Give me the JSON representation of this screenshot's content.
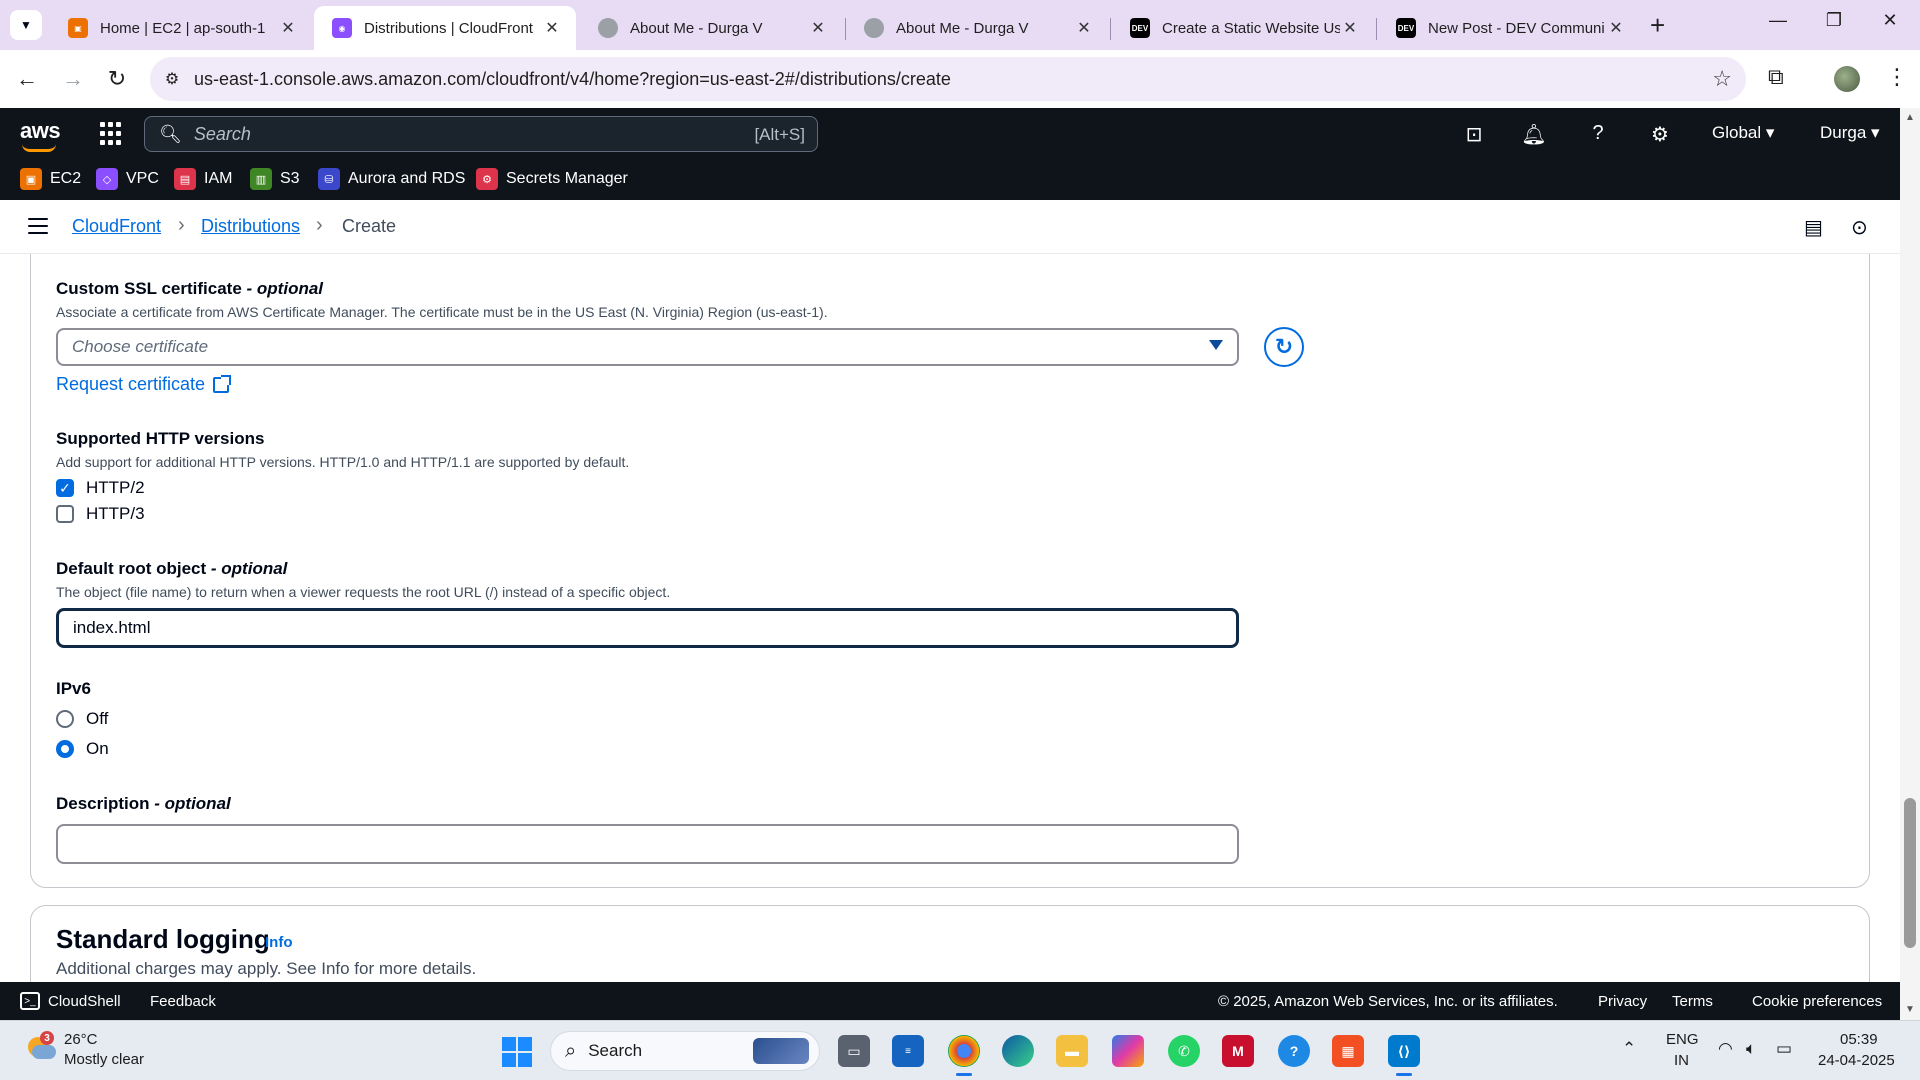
{
  "browser": {
    "tabs": [
      {
        "title": "Home | EC2 | ap-south-1",
        "icon": "aws-ec2-icon",
        "color": "#ed7100"
      },
      {
        "title": "Distributions | CloudFront",
        "icon": "aws-cloudfront-icon",
        "color": "#8c4fff"
      },
      {
        "title": "About Me - Durga V",
        "icon": "globe-icon",
        "color": "#9aa0a6"
      },
      {
        "title": "About Me - Durga V",
        "icon": "globe-icon",
        "color": "#9aa0a6"
      },
      {
        "title": "Create a Static Website Usi",
        "icon": "dev-icon",
        "color": "#000000"
      },
      {
        "title": "New Post - DEV Communi",
        "icon": "dev-icon",
        "color": "#000000"
      }
    ],
    "url": "us-east-1.console.aws.amazon.com/cloudfront/v4/home?region=us-east-2#/distributions/create"
  },
  "aws_header": {
    "logo": "aws",
    "search_placeholder": "Search",
    "search_shortcut": "[Alt+S]",
    "region": "Global",
    "user": "Durga"
  },
  "favorites": [
    {
      "label": "EC2",
      "icon": "ec2-icon",
      "color": "#ed7100"
    },
    {
      "label": "VPC",
      "icon": "vpc-icon",
      "color": "#8c4fff"
    },
    {
      "label": "IAM",
      "icon": "iam-icon",
      "color": "#dd344c"
    },
    {
      "label": "S3",
      "icon": "s3-icon",
      "color": "#3f8624"
    },
    {
      "label": "Aurora and RDS",
      "icon": "rds-icon",
      "color": "#3b48cc"
    },
    {
      "label": "Secrets Manager",
      "icon": "secrets-manager-icon",
      "color": "#dd344c"
    }
  ],
  "breadcrumb": {
    "items": [
      "CloudFront",
      "Distributions",
      "Create"
    ]
  },
  "form": {
    "ssl": {
      "label": "Custom SSL certificate",
      "optional": "- optional",
      "description": "Associate a certificate from AWS Certificate Manager. The certificate must be in the US East (N. Virginia) Region (us-east-1).",
      "placeholder": "Choose certificate",
      "request_link": "Request certificate"
    },
    "http": {
      "label": "Supported HTTP versions",
      "description": "Add support for additional HTTP versions. HTTP/1.0 and HTTP/1.1 are supported by default.",
      "options": [
        {
          "label": "HTTP/2",
          "checked": true
        },
        {
          "label": "HTTP/3",
          "checked": false
        }
      ]
    },
    "root_object": {
      "label": "Default root object",
      "optional": "- optional",
      "description": "The object (file name) to return when a viewer requests the root URL (/) instead of a specific object.",
      "value": "index.html"
    },
    "ipv6": {
      "label": "IPv6",
      "options": [
        {
          "label": "Off",
          "selected": false
        },
        {
          "label": "On",
          "selected": true
        }
      ]
    },
    "description_field": {
      "label": "Description",
      "optional": "- optional",
      "value": ""
    }
  },
  "logging": {
    "title": "Standard logging",
    "info": "Info",
    "description": "Additional charges may apply. See Info for more details."
  },
  "aws_footer": {
    "cloudshell": "CloudShell",
    "feedback": "Feedback",
    "copyright": "© 2025, Amazon Web Services, Inc. or its affiliates.",
    "privacy": "Privacy",
    "terms": "Terms",
    "cookies": "Cookie preferences"
  },
  "taskbar": {
    "weather_temp": "26°C",
    "weather_desc": "Mostly clear",
    "weather_badge": "3",
    "search_label": "Search",
    "lang_top": "ENG",
    "lang_bottom": "IN",
    "time": "05:39",
    "date": "24-04-2025"
  }
}
